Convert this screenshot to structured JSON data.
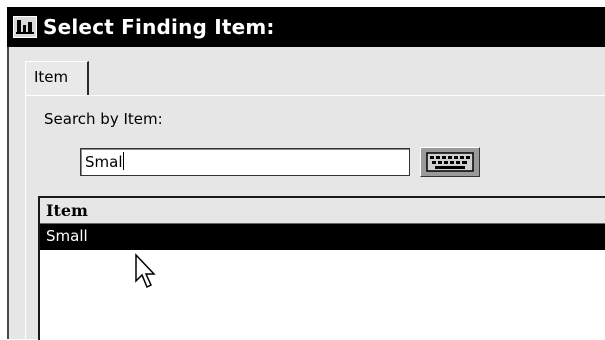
{
  "window": {
    "title": "Select Finding Item:"
  },
  "tabs": [
    {
      "label": "Item"
    }
  ],
  "search": {
    "label": "Search by Item:",
    "value": "Smal"
  },
  "list": {
    "column_header": "Item",
    "rows": [
      {
        "label": "Small",
        "selected": true
      }
    ]
  },
  "icons": {
    "title": "app-icon",
    "keyboard": "keyboard-icon",
    "cursor": "mouse-pointer-icon"
  },
  "colors": {
    "title_bar": "#000000",
    "window_bg": "#e6e6e6",
    "selection_bg": "#000000",
    "selection_text": "#ffffff"
  }
}
